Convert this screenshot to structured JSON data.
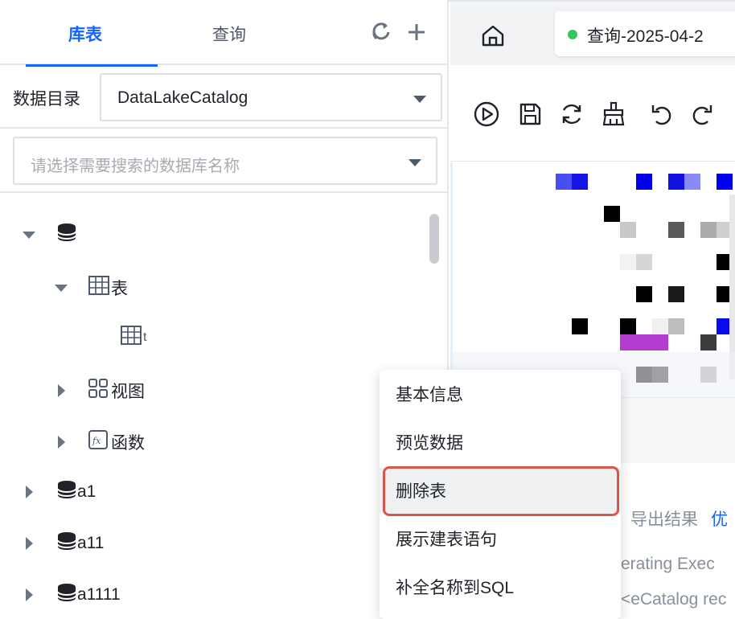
{
  "left_panel": {
    "tabs": [
      {
        "label": "库表",
        "active": true
      },
      {
        "label": "查询",
        "active": false
      }
    ],
    "catalog_label": "数据目录",
    "catalog_value": "DataLakeCatalog",
    "db_search_placeholder": "请选择需要搜索的数据库名称",
    "tree": {
      "table_group": "表",
      "table_item_partial": "t",
      "view_group": "视图",
      "func_group": "函数",
      "databases": [
        "a1",
        "a11",
        "a1111"
      ]
    }
  },
  "right_panel": {
    "query_tab_label": "查询-2025-04-2",
    "result_links": {
      "export": "导出结果",
      "optimize": "优"
    },
    "log_lines": [
      "erating Exec",
      "<eCatalog rec"
    ]
  },
  "context_menu": {
    "items": [
      {
        "label": "基本信息",
        "highlighted": false
      },
      {
        "label": "预览数据",
        "highlighted": false
      },
      {
        "label": "删除表",
        "highlighted": true
      },
      {
        "label": "展示建表语句",
        "highlighted": false
      },
      {
        "label": "补全名称到SQL",
        "highlighted": false
      }
    ]
  },
  "colors": {
    "accent": "#1664ff",
    "highlight_border": "#d9564a",
    "status_green": "#34c759"
  }
}
